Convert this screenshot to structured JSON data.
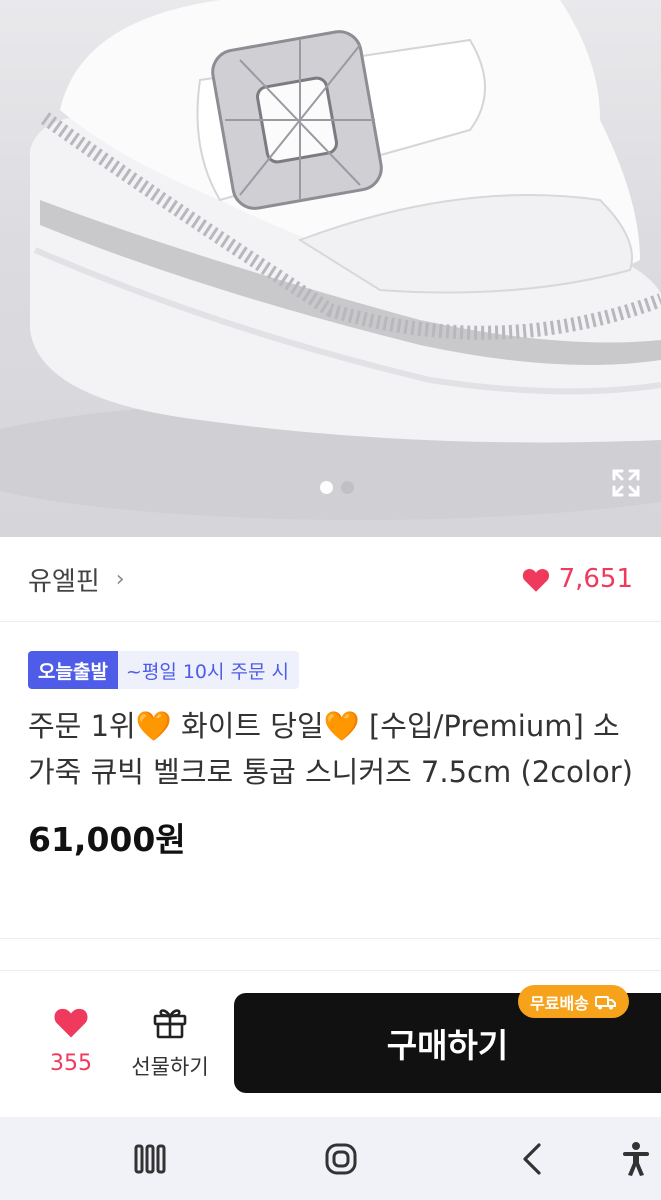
{
  "hero": {
    "image_alt": "white platform sneaker with crystal buckle",
    "dots_total": 2,
    "active_dot": 1,
    "expand_icon": "expand-icon"
  },
  "store": {
    "name": "유엘핀",
    "chevron": "›",
    "likes": "7,651"
  },
  "product": {
    "badge_main": "오늘출발",
    "badge_sub": "~평일 10시 주문 시",
    "title": "주문 1위🧡 화이트 당일🧡 [수입/Premium] 소가죽 큐빅 벨크로 통굽 스니커즈 7.5cm (2color)",
    "price": "61,000원"
  },
  "actions": {
    "wish_count": "355",
    "gift_label": "선물하기",
    "buy_label": "구매하기",
    "shipping_badge": "무료배송"
  },
  "colors": {
    "accent_pink": "#ef3a5d",
    "badge_blue": "#4f5ce8",
    "shipping_orange": "#f7a21b",
    "buy_black": "#111111"
  }
}
